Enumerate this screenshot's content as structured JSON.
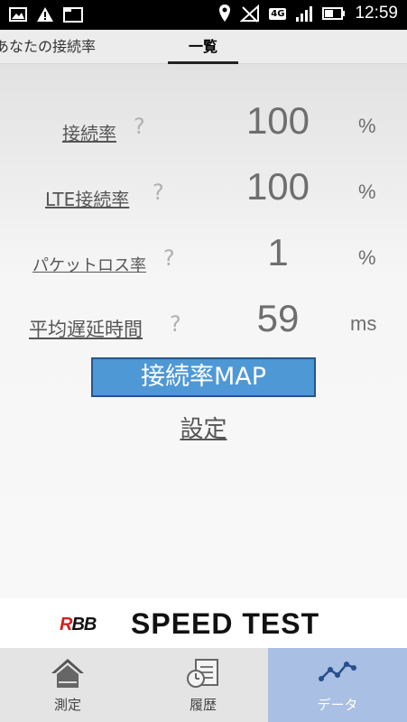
{
  "status_bar": {
    "time": "12:59",
    "network": "4G"
  },
  "tabs": {
    "mine": "あなたの接続率",
    "list": "一覧"
  },
  "rows": [
    {
      "label": "接続率",
      "value": "100",
      "unit": "%"
    },
    {
      "label": "LTE接続率",
      "value": "100",
      "unit": "%"
    },
    {
      "label": "パケットロス率",
      "value": "1",
      "unit": "%"
    },
    {
      "label": "平均遅延時間",
      "value": "59",
      "unit": "ms"
    }
  ],
  "help_glyph": "?",
  "buttons": {
    "map": "接続率MAP",
    "settings": "設定"
  },
  "brand": {
    "rbb_prefix": "R",
    "rbb_rest": "BB",
    "speed": "SPEED TEST"
  },
  "nav": {
    "measure": "測定",
    "history": "履歴",
    "data": "データ"
  },
  "colors": {
    "accent": "#4f98d6",
    "nav_selected": "#a9bfe3"
  }
}
